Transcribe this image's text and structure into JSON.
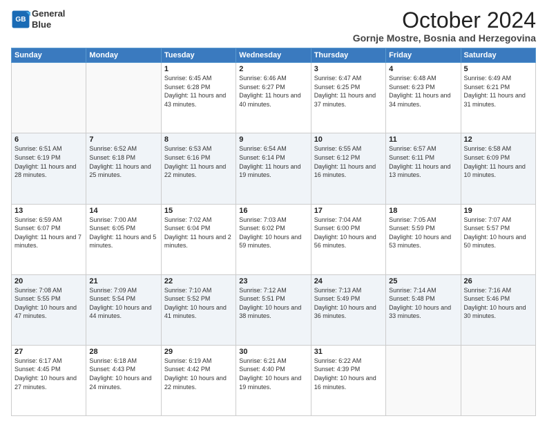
{
  "logo": {
    "line1": "General",
    "line2": "Blue"
  },
  "header": {
    "month": "October 2024",
    "location": "Gornje Mostre, Bosnia and Herzegovina"
  },
  "weekdays": [
    "Sunday",
    "Monday",
    "Tuesday",
    "Wednesday",
    "Thursday",
    "Friday",
    "Saturday"
  ],
  "weeks": [
    [
      {
        "day": "",
        "sunrise": "",
        "sunset": "",
        "daylight": ""
      },
      {
        "day": "",
        "sunrise": "",
        "sunset": "",
        "daylight": ""
      },
      {
        "day": "1",
        "sunrise": "Sunrise: 6:45 AM",
        "sunset": "Sunset: 6:28 PM",
        "daylight": "Daylight: 11 hours and 43 minutes."
      },
      {
        "day": "2",
        "sunrise": "Sunrise: 6:46 AM",
        "sunset": "Sunset: 6:27 PM",
        "daylight": "Daylight: 11 hours and 40 minutes."
      },
      {
        "day": "3",
        "sunrise": "Sunrise: 6:47 AM",
        "sunset": "Sunset: 6:25 PM",
        "daylight": "Daylight: 11 hours and 37 minutes."
      },
      {
        "day": "4",
        "sunrise": "Sunrise: 6:48 AM",
        "sunset": "Sunset: 6:23 PM",
        "daylight": "Daylight: 11 hours and 34 minutes."
      },
      {
        "day": "5",
        "sunrise": "Sunrise: 6:49 AM",
        "sunset": "Sunset: 6:21 PM",
        "daylight": "Daylight: 11 hours and 31 minutes."
      }
    ],
    [
      {
        "day": "6",
        "sunrise": "Sunrise: 6:51 AM",
        "sunset": "Sunset: 6:19 PM",
        "daylight": "Daylight: 11 hours and 28 minutes."
      },
      {
        "day": "7",
        "sunrise": "Sunrise: 6:52 AM",
        "sunset": "Sunset: 6:18 PM",
        "daylight": "Daylight: 11 hours and 25 minutes."
      },
      {
        "day": "8",
        "sunrise": "Sunrise: 6:53 AM",
        "sunset": "Sunset: 6:16 PM",
        "daylight": "Daylight: 11 hours and 22 minutes."
      },
      {
        "day": "9",
        "sunrise": "Sunrise: 6:54 AM",
        "sunset": "Sunset: 6:14 PM",
        "daylight": "Daylight: 11 hours and 19 minutes."
      },
      {
        "day": "10",
        "sunrise": "Sunrise: 6:55 AM",
        "sunset": "Sunset: 6:12 PM",
        "daylight": "Daylight: 11 hours and 16 minutes."
      },
      {
        "day": "11",
        "sunrise": "Sunrise: 6:57 AM",
        "sunset": "Sunset: 6:11 PM",
        "daylight": "Daylight: 11 hours and 13 minutes."
      },
      {
        "day": "12",
        "sunrise": "Sunrise: 6:58 AM",
        "sunset": "Sunset: 6:09 PM",
        "daylight": "Daylight: 11 hours and 10 minutes."
      }
    ],
    [
      {
        "day": "13",
        "sunrise": "Sunrise: 6:59 AM",
        "sunset": "Sunset: 6:07 PM",
        "daylight": "Daylight: 11 hours and 7 minutes."
      },
      {
        "day": "14",
        "sunrise": "Sunrise: 7:00 AM",
        "sunset": "Sunset: 6:05 PM",
        "daylight": "Daylight: 11 hours and 5 minutes."
      },
      {
        "day": "15",
        "sunrise": "Sunrise: 7:02 AM",
        "sunset": "Sunset: 6:04 PM",
        "daylight": "Daylight: 11 hours and 2 minutes."
      },
      {
        "day": "16",
        "sunrise": "Sunrise: 7:03 AM",
        "sunset": "Sunset: 6:02 PM",
        "daylight": "Daylight: 10 hours and 59 minutes."
      },
      {
        "day": "17",
        "sunrise": "Sunrise: 7:04 AM",
        "sunset": "Sunset: 6:00 PM",
        "daylight": "Daylight: 10 hours and 56 minutes."
      },
      {
        "day": "18",
        "sunrise": "Sunrise: 7:05 AM",
        "sunset": "Sunset: 5:59 PM",
        "daylight": "Daylight: 10 hours and 53 minutes."
      },
      {
        "day": "19",
        "sunrise": "Sunrise: 7:07 AM",
        "sunset": "Sunset: 5:57 PM",
        "daylight": "Daylight: 10 hours and 50 minutes."
      }
    ],
    [
      {
        "day": "20",
        "sunrise": "Sunrise: 7:08 AM",
        "sunset": "Sunset: 5:55 PM",
        "daylight": "Daylight: 10 hours and 47 minutes."
      },
      {
        "day": "21",
        "sunrise": "Sunrise: 7:09 AM",
        "sunset": "Sunset: 5:54 PM",
        "daylight": "Daylight: 10 hours and 44 minutes."
      },
      {
        "day": "22",
        "sunrise": "Sunrise: 7:10 AM",
        "sunset": "Sunset: 5:52 PM",
        "daylight": "Daylight: 10 hours and 41 minutes."
      },
      {
        "day": "23",
        "sunrise": "Sunrise: 7:12 AM",
        "sunset": "Sunset: 5:51 PM",
        "daylight": "Daylight: 10 hours and 38 minutes."
      },
      {
        "day": "24",
        "sunrise": "Sunrise: 7:13 AM",
        "sunset": "Sunset: 5:49 PM",
        "daylight": "Daylight: 10 hours and 36 minutes."
      },
      {
        "day": "25",
        "sunrise": "Sunrise: 7:14 AM",
        "sunset": "Sunset: 5:48 PM",
        "daylight": "Daylight: 10 hours and 33 minutes."
      },
      {
        "day": "26",
        "sunrise": "Sunrise: 7:16 AM",
        "sunset": "Sunset: 5:46 PM",
        "daylight": "Daylight: 10 hours and 30 minutes."
      }
    ],
    [
      {
        "day": "27",
        "sunrise": "Sunrise: 6:17 AM",
        "sunset": "Sunset: 4:45 PM",
        "daylight": "Daylight: 10 hours and 27 minutes."
      },
      {
        "day": "28",
        "sunrise": "Sunrise: 6:18 AM",
        "sunset": "Sunset: 4:43 PM",
        "daylight": "Daylight: 10 hours and 24 minutes."
      },
      {
        "day": "29",
        "sunrise": "Sunrise: 6:19 AM",
        "sunset": "Sunset: 4:42 PM",
        "daylight": "Daylight: 10 hours and 22 minutes."
      },
      {
        "day": "30",
        "sunrise": "Sunrise: 6:21 AM",
        "sunset": "Sunset: 4:40 PM",
        "daylight": "Daylight: 10 hours and 19 minutes."
      },
      {
        "day": "31",
        "sunrise": "Sunrise: 6:22 AM",
        "sunset": "Sunset: 4:39 PM",
        "daylight": "Daylight: 10 hours and 16 minutes."
      },
      {
        "day": "",
        "sunrise": "",
        "sunset": "",
        "daylight": ""
      },
      {
        "day": "",
        "sunrise": "",
        "sunset": "",
        "daylight": ""
      }
    ]
  ]
}
